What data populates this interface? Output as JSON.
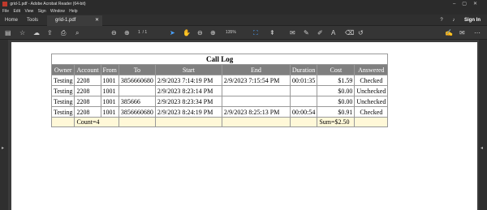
{
  "window": {
    "title": "grid-1.pdf - Adobe Acrobat Reader (64-bit)"
  },
  "menu": [
    "File",
    "Edit",
    "View",
    "Sign",
    "Window",
    "Help"
  ],
  "tabs": {
    "home": "Home",
    "tools": "Tools",
    "document": "grid-1.pdf"
  },
  "header": {
    "sign_in": "Sign In"
  },
  "toolbar": {
    "page_current": "1",
    "page_total": "/ 1",
    "zoom": "135%"
  },
  "table": {
    "title": "Call Log",
    "columns": [
      "Owner",
      "Account",
      "From",
      "To",
      "Start",
      "End",
      "Duration",
      "Cost",
      "Answered"
    ],
    "rows": [
      [
        "Testing",
        "2208",
        "1001",
        "3856660680",
        "2/9/2023 7:14:19 PM",
        "2/9/2023 7:15:54 PM",
        "00:01:35",
        "$1.59",
        "Checked"
      ],
      [
        "Testing",
        "2208",
        "1001",
        "",
        "2/9/2023 8:23:14 PM",
        "",
        "",
        "$0.00",
        "Unchecked"
      ],
      [
        "Testing",
        "2208",
        "1001",
        "385666",
        "2/9/2023 8:23:34 PM",
        "",
        "",
        "$0.00",
        "Unchecked"
      ],
      [
        "Testing",
        "2208",
        "1001",
        "3856660680",
        "2/9/2023 8:24:19 PM",
        "2/9/2023 8:25:13 PM",
        "00:00:54",
        "$0.91",
        "Checked"
      ]
    ],
    "footer": {
      "count": "Count=4",
      "sum": "Sum=$2.50"
    }
  }
}
